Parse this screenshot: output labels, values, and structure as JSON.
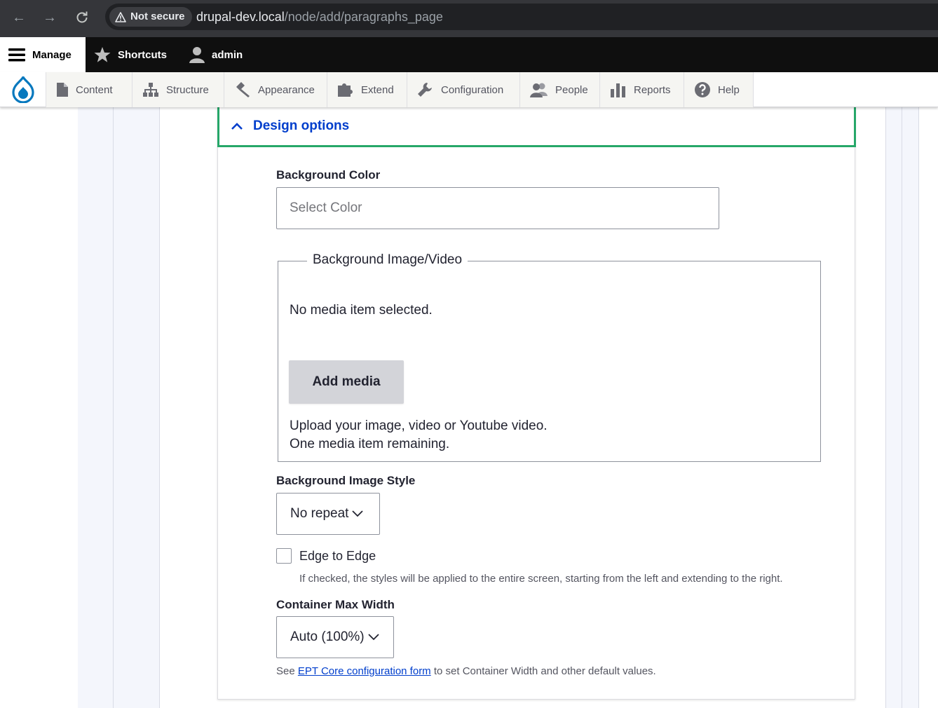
{
  "browser": {
    "security_label": "Not secure",
    "url_host": "drupal-dev.local",
    "url_path": "/node/add/paragraphs_page"
  },
  "toolbar": {
    "manage": "Manage",
    "shortcuts": "Shortcuts",
    "user": "admin"
  },
  "admin_menu": {
    "items": [
      {
        "label": "Content",
        "icon": "file-icon"
      },
      {
        "label": "Structure",
        "icon": "sitemap-icon"
      },
      {
        "label": "Appearance",
        "icon": "paintbrush-icon"
      },
      {
        "label": "Extend",
        "icon": "puzzle-icon"
      },
      {
        "label": "Configuration",
        "icon": "wrench-icon"
      },
      {
        "label": "People",
        "icon": "people-icon"
      },
      {
        "label": "Reports",
        "icon": "bar-chart-icon"
      },
      {
        "label": "Help",
        "icon": "help-icon"
      }
    ]
  },
  "details": {
    "title": "Design options"
  },
  "form": {
    "bg_color_label": "Background Color",
    "bg_color_placeholder": "Select Color",
    "media_legend": "Background Image/Video",
    "media_empty": "No media item selected.",
    "add_media": "Add media",
    "media_help_1": "Upload your image, video or Youtube video.",
    "media_help_2": "One media item remaining.",
    "image_style_label": "Background Image Style",
    "image_style_value": "No repeat",
    "edge_label": "Edge to Edge",
    "edge_desc": "If checked, the styles will be applied to the entire screen, starting from the left and extending to the right.",
    "container_label": "Container Max Width",
    "container_value": "Auto (100%)",
    "see_prefix": "See",
    "see_link": "EPT Core configuration form",
    "see_suffix": "to set Container Width and other default values."
  },
  "colors": {
    "accent_green": "#26a769",
    "link_blue": "#003ecc",
    "drupal_blue": "#0678be"
  }
}
